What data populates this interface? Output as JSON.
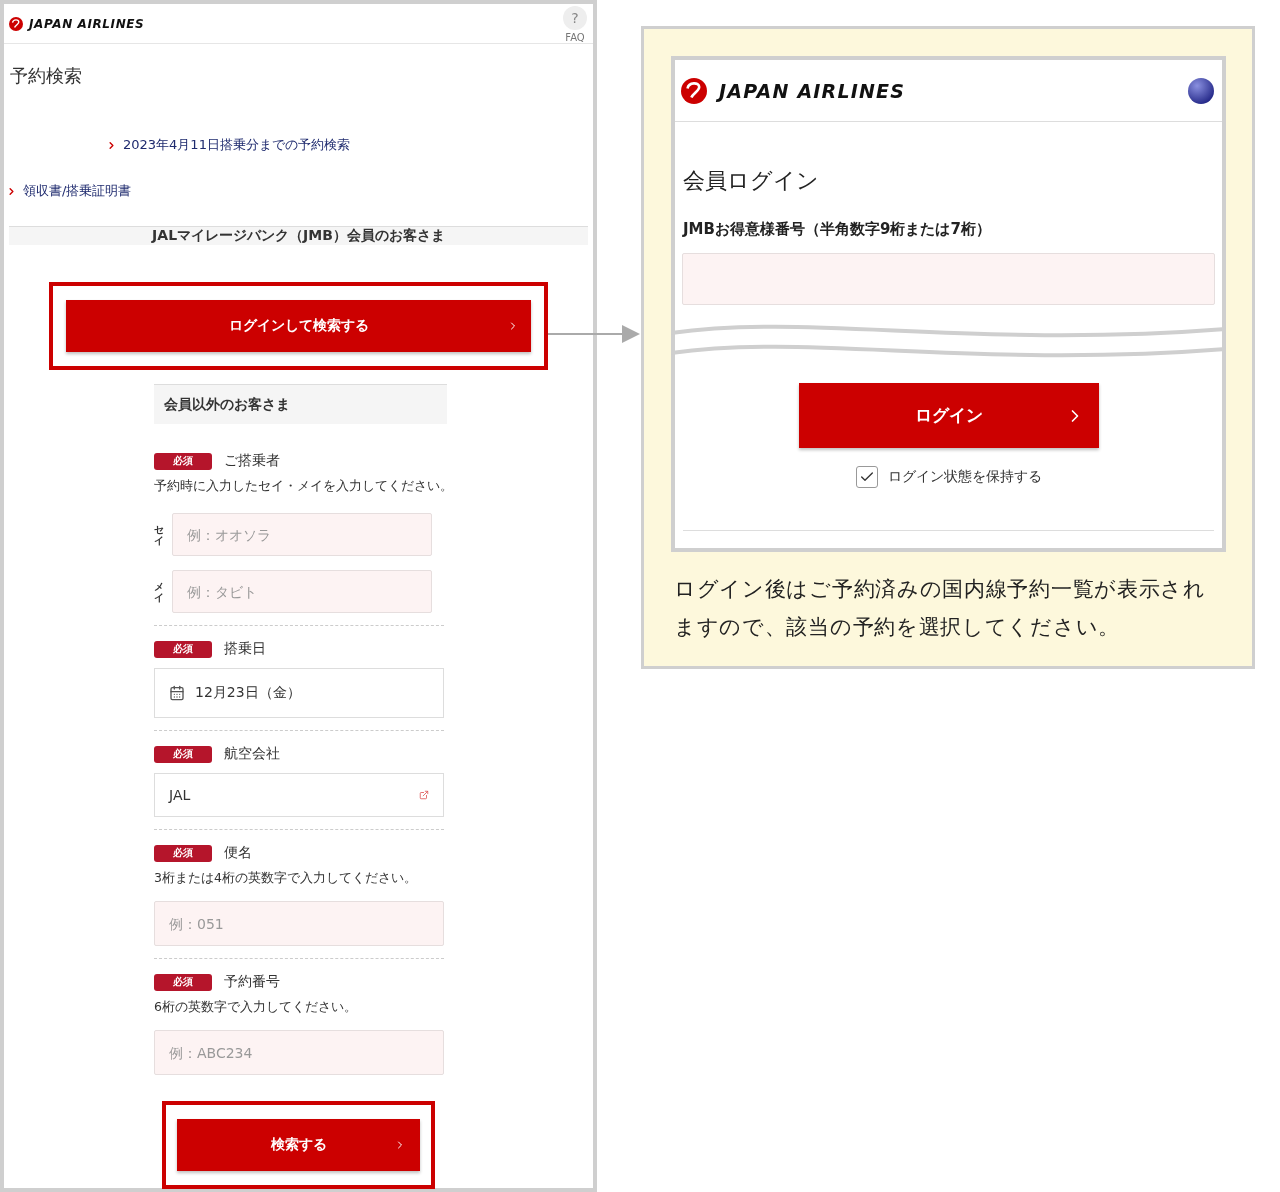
{
  "left_page": {
    "header": {
      "logo": "JAPAN AIRLINES",
      "faq_icon": "?",
      "faq": "FAQ"
    },
    "title": "予約検索",
    "links": [
      {
        "text": "2023年4月11日搭乗分までの予約検索",
        "indented": true
      },
      {
        "text": "領収書/搭乗証明書",
        "indented": false
      }
    ],
    "member_heading": "JALマイレージバンク（JMB）会員のお客さま",
    "member_button": {
      "label": "ログインして検索する",
      "highlighted": true
    },
    "guest_heading": "会員以外のお客さま",
    "fields": [
      {
        "kind": "name",
        "badge": "必須",
        "label": "ご搭乗者",
        "hint": "予約時に入力したセイ・メイを入力してください。",
        "inputs": [
          {
            "side_label": "セイ",
            "placeholder": "例：オオソラ"
          },
          {
            "side_label": "メイ",
            "placeholder": "例：タビト"
          }
        ]
      },
      {
        "kind": "date",
        "badge": "必須",
        "label": "搭乗日",
        "value": "12月23日（金）"
      },
      {
        "kind": "select",
        "badge": "必須",
        "label": "航空会社",
        "value": "JAL"
      },
      {
        "kind": "text",
        "badge": "必須",
        "label": "便名",
        "hint": "3桁または4桁の英数字で入力してください。",
        "placeholder": "例：051"
      },
      {
        "kind": "text",
        "badge": "必須",
        "label": "予約番号",
        "hint": "6桁の英数字で入力してください。",
        "placeholder": "例：ABC234"
      }
    ],
    "search_button": {
      "label": "検索する",
      "highlighted": true
    }
  },
  "callout": {
    "login_mock": {
      "logo": "JAPAN AIRLINES",
      "title": "会員ログイン",
      "field_label": "JMBお得意様番号（半角数字9桁または7桁）",
      "login_button": {
        "label": "ログイン"
      },
      "keep_login": {
        "label": "ログイン状態を保持する",
        "checked": true
      }
    },
    "caption": "ログイン後はご予約済みの国内線予約一覧が表示されますので、該当の予約を選択してください。"
  }
}
